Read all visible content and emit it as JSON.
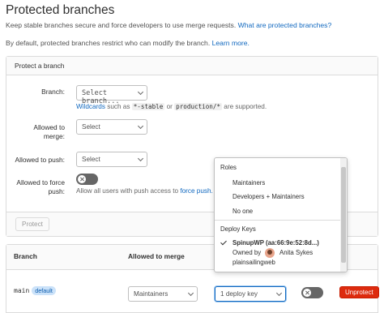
{
  "page": {
    "title": "Protected branches",
    "intro_text": "Keep stable branches secure and force developers to use merge requests. ",
    "intro_link": "What are protected branches?",
    "default_text": "By default, protected branches restrict who can modify the branch. ",
    "default_link": "Learn more."
  },
  "form": {
    "header": "Protect a branch",
    "branch_label": "Branch:",
    "branch_placeholder": "Select branch...",
    "wildcards_link": "Wildcards",
    "wildcards_text_1": " such as ",
    "wildcard_example_1": "*-stable",
    "wildcards_text_2": " or ",
    "wildcard_example_2": "production/*",
    "wildcards_text_3": " are supported.",
    "merge_label_1": "Allowed to",
    "merge_label_2": "merge:",
    "merge_placeholder": "Select",
    "push_label": "Allowed to push:",
    "push_placeholder": "Select",
    "force_label_1": "Allowed to force",
    "force_label_2": "push:",
    "force_help": "Allow all users with push access to ",
    "force_help_link": "force push.",
    "protect_button": "Protect"
  },
  "table": {
    "headers": {
      "branch": "Branch",
      "merge": "Allowed to merge"
    },
    "rows": [
      {
        "branch": "main",
        "badge": "default",
        "merge_value": "Maintainers",
        "push_value": "1 deploy key",
        "unprotect": "Unprotect"
      }
    ]
  },
  "dropdown_menu": {
    "roles_header": "Roles",
    "roles": [
      "Maintainers",
      "Developers + Maintainers",
      "No one"
    ],
    "deploy_keys_header": "Deploy Keys",
    "deploy_key": {
      "name": "SpinupWP (aa:66:9e:52:8d...)",
      "owned_by": "Owned by",
      "owner": "Anita Sykes",
      "project": "plainsailingweb",
      "selected": true
    }
  },
  "colors": {
    "link": "#1068bf",
    "danger": "#dd2b0e",
    "badge_bg": "#cbe2f9"
  }
}
